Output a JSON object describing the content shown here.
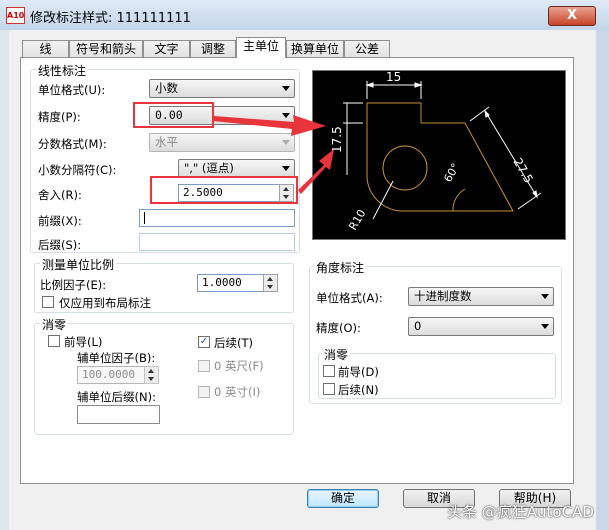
{
  "window": {
    "title": "修改标注样式: 111111111",
    "icon": "A10",
    "close_label": "X"
  },
  "tabs": [
    {
      "label": "线",
      "active": false
    },
    {
      "label": "符号和箭头",
      "active": false
    },
    {
      "label": "文字",
      "active": false
    },
    {
      "label": "调整",
      "active": false
    },
    {
      "label": "主单位",
      "active": true
    },
    {
      "label": "换算单位",
      "active": false
    },
    {
      "label": "公差",
      "active": false
    }
  ],
  "linear": {
    "legend": "线性标注",
    "unit_format_label": "单位格式(U):",
    "unit_format_value": "小数",
    "precision_label": "精度(P):",
    "precision_value": "0.00",
    "fraction_label": "分数格式(M):",
    "fraction_value": "水平",
    "decimal_sep_label": "小数分隔符(C):",
    "decimal_sep_value": "\",\" (逗点)",
    "roundoff_label": "舍入(R):",
    "roundoff_value": "2.5000",
    "prefix_label": "前缀(X):",
    "prefix_value": "",
    "suffix_label": "后缀(S):",
    "suffix_value": ""
  },
  "scale": {
    "legend": "测量单位比例",
    "factor_label": "比例因子(E):",
    "factor_value": "1.0000",
    "layout_only_label": "仅应用到布局标注"
  },
  "zero_linear": {
    "legend": "消零",
    "leading_label": "前导(L)",
    "trailing_label": "后续(T)",
    "sub_factor_label": "辅单位因子(B):",
    "sub_factor_value": "100.0000",
    "sub_suffix_label": "辅单位后缀(N):",
    "sub_suffix_value": "",
    "feet_label": "0 英尺(F)",
    "inches_label": "0 英寸(I)"
  },
  "angular": {
    "legend": "角度标注",
    "unit_format_label": "单位格式(A):",
    "unit_format_value": "十进制度数",
    "precision_label": "精度(O):",
    "precision_value": "0",
    "zero_legend": "消零",
    "leading_label": "前导(D)",
    "trailing_label": "后续(N)"
  },
  "preview": {
    "dim_top": "15",
    "dim_left": "17.5",
    "dim_right": "27.5",
    "dim_angle": "60°",
    "dim_radius": "R10"
  },
  "buttons": {
    "ok": "确定",
    "cancel": "取消",
    "help": "帮助(H)"
  },
  "watermark": "头条 @疯狂AutoCAD",
  "colors": {
    "highlight": "#e8343a",
    "preview_geometry": "#c8913a",
    "preview_dims": "#ffffff"
  }
}
